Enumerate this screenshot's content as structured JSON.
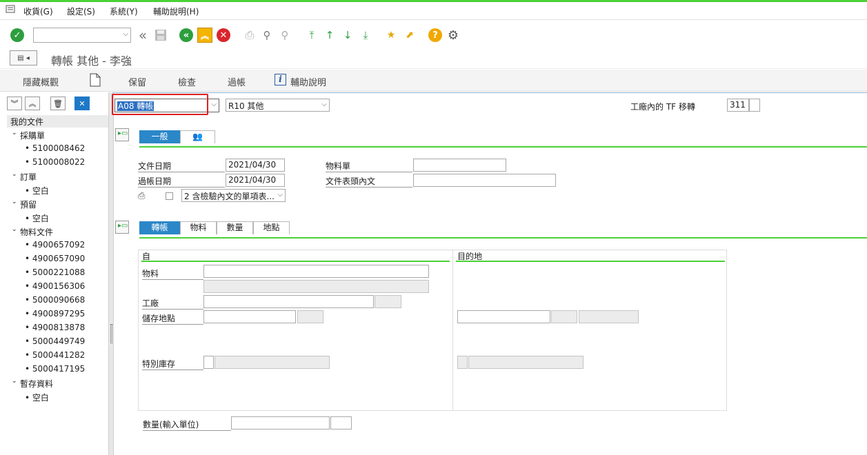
{
  "menu": {
    "items": [
      "收貨(G)",
      "設定(S)",
      "系統(Y)",
      "輔助說明(H)"
    ]
  },
  "toolbar": {
    "command_value": ""
  },
  "title": "轉帳 其他 - 李強",
  "app_toolbar": {
    "hide_overview": "隱藏概觀",
    "hold": "保留",
    "check": "檢查",
    "post": "過帳",
    "help": "輔助說明"
  },
  "sidebar": {
    "root": "我的文件",
    "groups": [
      {
        "label": "採購單",
        "items": [
          "5100008462",
          "5100008022"
        ]
      },
      {
        "label": "訂單",
        "items": [
          "空白"
        ]
      },
      {
        "label": "預留",
        "items": [
          "空白"
        ]
      },
      {
        "label": "物料文件",
        "items": [
          "4900657092",
          "4900657090",
          "5000221088",
          "4900156306",
          "5000090668",
          "4900897295",
          "4900813878",
          "5000449749",
          "5000441282",
          "5000417195"
        ]
      },
      {
        "label": "暫存資料",
        "items": [
          "空白"
        ]
      }
    ]
  },
  "header": {
    "transaction": "A08 轉帳",
    "reference": "R10 其他",
    "movement_label": "工廠內的 TF 移轉",
    "movement_type": "311"
  },
  "general_tabs": [
    "一般",
    ""
  ],
  "general": {
    "doc_date_label": "文件日期",
    "doc_date": "2021/04/30",
    "post_date_label": "過帳日期",
    "post_date": "2021/04/30",
    "print_option": "2 含檢驗內文的單項表...",
    "slip_label": "物料單",
    "slip_value": "",
    "header_text_label": "文件表頭內文",
    "header_text_value": ""
  },
  "item_tabs": [
    "轉帳",
    "物料",
    "數量",
    "地點"
  ],
  "transfer": {
    "from_title": "自",
    "to_title": "目的地",
    "material_label": "物料",
    "plant_label": "工廠",
    "sloc_label": "儲存地點",
    "special_stock_label": "特別庫存",
    "qty_label": "數量(輸入單位)"
  },
  "colors": {
    "accent_green": "#4cd137",
    "tab_blue": "#2b87c8",
    "highlight_red": "#e02020"
  }
}
